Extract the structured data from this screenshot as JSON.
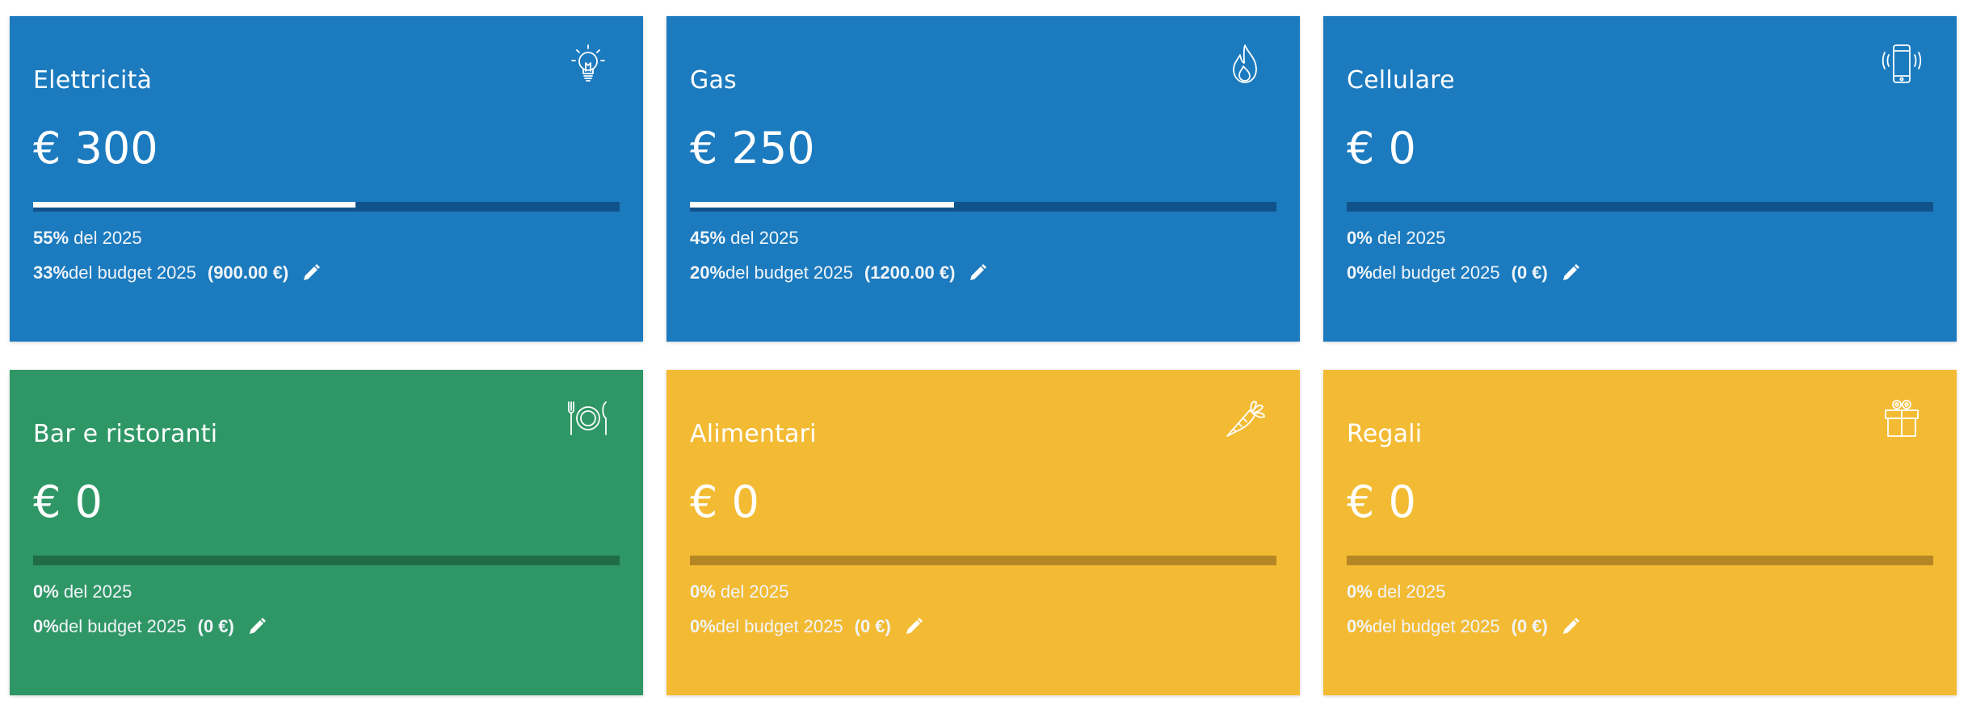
{
  "colors": {
    "blue": "#1c7bbf",
    "green": "#2f9766",
    "yellow": "#f3bb33"
  },
  "cards": [
    {
      "title": "Elettricità",
      "icon": "lightbulb-icon",
      "amount": "€ 300",
      "progress_percent": 55,
      "year_pct": "55%",
      "year_text": " del 2025",
      "budget_pct": "33%",
      "budget_text": " del budget 2025",
      "budget_value": "(900.00 €)",
      "color": "blue"
    },
    {
      "title": "Gas",
      "icon": "flame-icon",
      "amount": "€ 250",
      "progress_percent": 45,
      "year_pct": "45%",
      "year_text": " del 2025",
      "budget_pct": "20%",
      "budget_text": " del budget 2025",
      "budget_value": "(1200.00 €)",
      "color": "blue"
    },
    {
      "title": "Cellulare",
      "icon": "smartphone-icon",
      "amount": "€ 0",
      "progress_percent": 0,
      "year_pct": "0%",
      "year_text": " del 2025",
      "budget_pct": "0%",
      "budget_text": " del budget 2025",
      "budget_value": "(0 €)",
      "color": "blue"
    },
    {
      "title": "Bar e ristoranti",
      "icon": "cutlery-plate-icon",
      "amount": "€ 0",
      "progress_percent": 0,
      "year_pct": "0%",
      "year_text": " del 2025",
      "budget_pct": "0%",
      "budget_text": " del budget 2025",
      "budget_value": "(0 €)",
      "color": "green"
    },
    {
      "title": "Alimentari",
      "icon": "carrot-icon",
      "amount": "€ 0",
      "progress_percent": 0,
      "year_pct": "0%",
      "year_text": " del 2025",
      "budget_pct": "0%",
      "budget_text": " del budget 2025",
      "budget_value": "(0 €)",
      "color": "yellow"
    },
    {
      "title": "Regali",
      "icon": "gift-icon",
      "amount": "€ 0",
      "progress_percent": 0,
      "year_pct": "0%",
      "year_text": " del 2025",
      "budget_pct": "0%",
      "budget_text": " del budget 2025",
      "budget_value": "(0 €)",
      "color": "yellow"
    }
  ]
}
